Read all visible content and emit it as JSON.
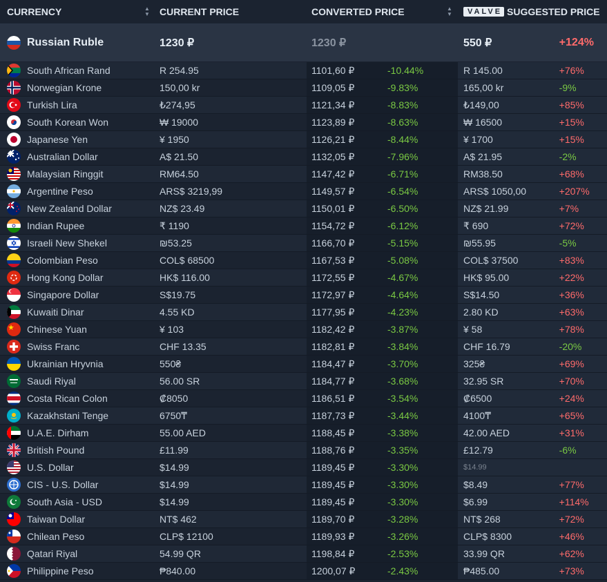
{
  "header": {
    "currency": "CURRENCY",
    "current_price": "CURRENT PRICE",
    "converted_price": "CONVERTED PRICE",
    "valve_logo": "VALVE",
    "suggested_price": "SUGGESTED PRICE"
  },
  "highlight": {
    "currency": "Russian Ruble",
    "flag": "russia-flag-icon",
    "current": "1230 ₽",
    "converted": "1230 ₽",
    "suggested": "550 ₽",
    "suggested_pct": "+124%"
  },
  "rows": [
    {
      "currency": "South African Rand",
      "flag": "south-africa",
      "current": "R 254.95",
      "converted": "1101,60 ₽",
      "converted_pct": "-10.44%",
      "suggested": "R 145.00",
      "suggested_pct": "+76%"
    },
    {
      "currency": "Norwegian Krone",
      "flag": "norway",
      "current": "150,00 kr",
      "converted": "1109,05 ₽",
      "converted_pct": "-9.83%",
      "suggested": "165,00 kr",
      "suggested_pct": "-9%"
    },
    {
      "currency": "Turkish Lira",
      "flag": "turkey",
      "current": "₺274,95",
      "converted": "1121,34 ₽",
      "converted_pct": "-8.83%",
      "suggested": "₺149,00",
      "suggested_pct": "+85%"
    },
    {
      "currency": "South Korean Won",
      "flag": "south-korea",
      "current": "₩ 19000",
      "converted": "1123,89 ₽",
      "converted_pct": "-8.63%",
      "suggested": "₩ 16500",
      "suggested_pct": "+15%"
    },
    {
      "currency": "Japanese Yen",
      "flag": "japan",
      "current": "¥ 1950",
      "converted": "1126,21 ₽",
      "converted_pct": "-8.44%",
      "suggested": "¥ 1700",
      "suggested_pct": "+15%"
    },
    {
      "currency": "Australian Dollar",
      "flag": "australia",
      "current": "A$ 21.50",
      "converted": "1132,05 ₽",
      "converted_pct": "-7.96%",
      "suggested": "A$ 21.95",
      "suggested_pct": "-2%"
    },
    {
      "currency": "Malaysian Ringgit",
      "flag": "malaysia",
      "current": "RM64.50",
      "converted": "1147,42 ₽",
      "converted_pct": "-6.71%",
      "suggested": "RM38.50",
      "suggested_pct": "+68%"
    },
    {
      "currency": "Argentine Peso",
      "flag": "argentina",
      "current": "ARS$ 3219,99",
      "converted": "1149,57 ₽",
      "converted_pct": "-6.54%",
      "suggested": "ARS$ 1050,00",
      "suggested_pct": "+207%"
    },
    {
      "currency": "New Zealand Dollar",
      "flag": "new-zealand",
      "current": "NZ$ 23.49",
      "converted": "1150,01 ₽",
      "converted_pct": "-6.50%",
      "suggested": "NZ$ 21.99",
      "suggested_pct": "+7%"
    },
    {
      "currency": "Indian Rupee",
      "flag": "india",
      "current": "₹ 1190",
      "converted": "1154,72 ₽",
      "converted_pct": "-6.12%",
      "suggested": "₹ 690",
      "suggested_pct": "+72%"
    },
    {
      "currency": "Israeli New Shekel",
      "flag": "israel",
      "current": "₪53.25",
      "converted": "1166,70 ₽",
      "converted_pct": "-5.15%",
      "suggested": "₪55.95",
      "suggested_pct": "-5%"
    },
    {
      "currency": "Colombian Peso",
      "flag": "colombia",
      "current": "COL$ 68500",
      "converted": "1167,53 ₽",
      "converted_pct": "-5.08%",
      "suggested": "COL$ 37500",
      "suggested_pct": "+83%"
    },
    {
      "currency": "Hong Kong Dollar",
      "flag": "hong-kong",
      "current": "HK$ 116.00",
      "converted": "1172,55 ₽",
      "converted_pct": "-4.67%",
      "suggested": "HK$ 95.00",
      "suggested_pct": "+22%"
    },
    {
      "currency": "Singapore Dollar",
      "flag": "singapore",
      "current": "S$19.75",
      "converted": "1172,97 ₽",
      "converted_pct": "-4.64%",
      "suggested": "S$14.50",
      "suggested_pct": "+36%"
    },
    {
      "currency": "Kuwaiti Dinar",
      "flag": "kuwait",
      "current": "4.55 KD",
      "converted": "1177,95 ₽",
      "converted_pct": "-4.23%",
      "suggested": "2.80 KD",
      "suggested_pct": "+63%"
    },
    {
      "currency": "Chinese Yuan",
      "flag": "china",
      "current": "¥ 103",
      "converted": "1182,42 ₽",
      "converted_pct": "-3.87%",
      "suggested": "¥ 58",
      "suggested_pct": "+78%"
    },
    {
      "currency": "Swiss Franc",
      "flag": "switzerland",
      "current": "CHF 13.35",
      "converted": "1182,81 ₽",
      "converted_pct": "-3.84%",
      "suggested": "CHF 16.79",
      "suggested_pct": "-20%"
    },
    {
      "currency": "Ukrainian Hryvnia",
      "flag": "ukraine",
      "current": "550₴",
      "converted": "1184,47 ₽",
      "converted_pct": "-3.70%",
      "suggested": "325₴",
      "suggested_pct": "+69%"
    },
    {
      "currency": "Saudi Riyal",
      "flag": "saudi-arabia",
      "current": "56.00 SR",
      "converted": "1184,77 ₽",
      "converted_pct": "-3.68%",
      "suggested": "32.95 SR",
      "suggested_pct": "+70%"
    },
    {
      "currency": "Costa Rican Colon",
      "flag": "costa-rica",
      "current": "₡8050",
      "converted": "1186,51 ₽",
      "converted_pct": "-3.54%",
      "suggested": "₡6500",
      "suggested_pct": "+24%"
    },
    {
      "currency": "Kazakhstani Tenge",
      "flag": "kazakhstan",
      "current": "6750₸",
      "converted": "1187,73 ₽",
      "converted_pct": "-3.44%",
      "suggested": "4100₸",
      "suggested_pct": "+65%"
    },
    {
      "currency": "U.A.E. Dirham",
      "flag": "uae",
      "current": "55.00 AED",
      "converted": "1188,45 ₽",
      "converted_pct": "-3.38%",
      "suggested": "42.00 AED",
      "suggested_pct": "+31%"
    },
    {
      "currency": "British Pound",
      "flag": "uk",
      "current": "£11.99",
      "converted": "1188,76 ₽",
      "converted_pct": "-3.35%",
      "suggested": "£12.79",
      "suggested_pct": "-6%"
    },
    {
      "currency": "U.S. Dollar",
      "flag": "usa",
      "current": "$14.99",
      "converted": "1189,45 ₽",
      "converted_pct": "-3.30%",
      "suggested": "$14.99",
      "suggested_pct": "",
      "suggested_muted": true
    },
    {
      "currency": "CIS - U.S. Dollar",
      "flag": "cis",
      "current": "$14.99",
      "converted": "1189,45 ₽",
      "converted_pct": "-3.30%",
      "suggested": "$8.49",
      "suggested_pct": "+77%"
    },
    {
      "currency": "South Asia - USD",
      "flag": "south-asia",
      "current": "$14.99",
      "converted": "1189,45 ₽",
      "converted_pct": "-3.30%",
      "suggested": "$6.99",
      "suggested_pct": "+114%"
    },
    {
      "currency": "Taiwan Dollar",
      "flag": "taiwan",
      "current": "NT$ 462",
      "converted": "1189,70 ₽",
      "converted_pct": "-3.28%",
      "suggested": "NT$ 268",
      "suggested_pct": "+72%"
    },
    {
      "currency": "Chilean Peso",
      "flag": "chile",
      "current": "CLP$ 12100",
      "converted": "1189,93 ₽",
      "converted_pct": "-3.26%",
      "suggested": "CLP$ 8300",
      "suggested_pct": "+46%"
    },
    {
      "currency": "Qatari Riyal",
      "flag": "qatar",
      "current": "54.99 QR",
      "converted": "1198,84 ₽",
      "converted_pct": "-2.53%",
      "suggested": "33.99 QR",
      "suggested_pct": "+62%"
    },
    {
      "currency": "Philippine Peso",
      "flag": "philippines",
      "current": "₱840.00",
      "converted": "1200,07 ₽",
      "converted_pct": "-2.43%",
      "suggested": "₱485.00",
      "suggested_pct": "+73%"
    }
  ],
  "colors": {
    "background": "#1b2330",
    "highlight_row": "#2a3444",
    "negative": "#7ac943",
    "positive": "#ff6b6b"
  }
}
